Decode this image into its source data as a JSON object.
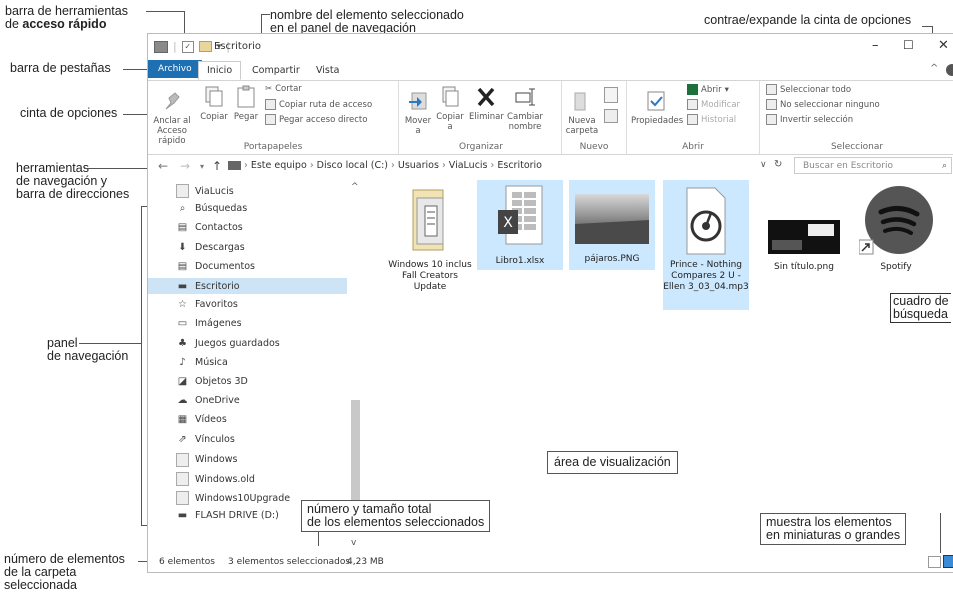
{
  "annotations": {
    "qat_1": "barra de herramientas",
    "qat_2_pre": "de ",
    "qat_2_bold": "acceso rápido",
    "selname_1": "nombre del elemento seleccionado",
    "selname_2": "en el panel de navegación",
    "collapse": "contrae/expande la cinta de opciones",
    "tabsbar": "barra de pestañas",
    "ribbon": "cinta de opciones",
    "navtools_1": "herramientas",
    "navtools_2": "de navegación y",
    "navtools_3": "barra de direcciones",
    "navpane_1": "panel",
    "navpane_2": "de navegación",
    "searchbox_1": "cuadro de",
    "searchbox_2": "búsqueda",
    "viewarea": "área de visualización",
    "selcount_1": "número y tamaño total",
    "selcount_2": "de los elementos seleccionados",
    "viewmode_1": "muestra los elementos",
    "viewmode_2": "en miniaturas o grandes",
    "itemcount_1": "número de elementos",
    "itemcount_2": "de la carpeta",
    "itemcount_3": "seleccionada"
  },
  "window": {
    "title": "Escritorio",
    "minimize": "–",
    "maximize": "☐",
    "close": "✕"
  },
  "tabs": [
    "Archivo",
    "Inicio",
    "Compartir",
    "Vista"
  ],
  "ribbon": {
    "pin": "Anclar al Acceso rápido",
    "copy": "Copiar",
    "paste": "Pegar",
    "cut": "Cortar",
    "copy_path": "Copiar ruta de acceso",
    "paste_shortcut": "Pegar acceso directo",
    "group_clipboard": "Portapapeles",
    "move": "Mover a",
    "copy_to": "Copiar a",
    "delete": "Eliminar",
    "rename": "Cambiar nombre",
    "group_organize": "Organizar",
    "new_folder": "Nueva carpeta",
    "group_new": "Nuevo",
    "properties": "Propiedades",
    "open": "Abrir",
    "edit": "Modificar",
    "history": "Historial",
    "group_open": "Abrir",
    "select_all": "Seleccionar todo",
    "select_none": "No seleccionar ninguno",
    "invert": "Invertir selección",
    "group_select": "Seleccionar"
  },
  "address": {
    "path": [
      "Este equipo",
      "Disco local (C:)",
      "Usuarios",
      "ViaLucis",
      "Escritorio"
    ],
    "search_placeholder": "Buscar en Escritorio"
  },
  "nav_items": [
    {
      "label": "ViaLucis",
      "icon": "folder-icon"
    },
    {
      "label": "Búsquedas",
      "icon": "search-icon"
    },
    {
      "label": "Contactos",
      "icon": "contacts-icon"
    },
    {
      "label": "Descargas",
      "icon": "download-icon"
    },
    {
      "label": "Documentos",
      "icon": "document-icon"
    },
    {
      "label": "Escritorio",
      "icon": "desktop-icon"
    },
    {
      "label": "Favoritos",
      "icon": "star-icon"
    },
    {
      "label": "Imágenes",
      "icon": "pictures-icon"
    },
    {
      "label": "Juegos guardados",
      "icon": "games-icon"
    },
    {
      "label": "Música",
      "icon": "music-icon"
    },
    {
      "label": "Objetos 3D",
      "icon": "cube-icon"
    },
    {
      "label": "OneDrive",
      "icon": "cloud-icon"
    },
    {
      "label": "Vídeos",
      "icon": "video-icon"
    },
    {
      "label": "Vínculos",
      "icon": "link-icon"
    },
    {
      "label": "Windows",
      "icon": "folder-icon"
    },
    {
      "label": "Windows.old",
      "icon": "folder-icon"
    },
    {
      "label": "Windows10Upgrade",
      "icon": "folder-icon"
    },
    {
      "label": "FLASH DRIVE (D:)",
      "icon": "drive-icon"
    }
  ],
  "files": [
    {
      "name": "Windows 10 inclus Fall Creators Update",
      "kind": "folder",
      "selected": false
    },
    {
      "name": "Libro1.xlsx",
      "kind": "excel",
      "selected": true
    },
    {
      "name": "pájaros.PNG",
      "kind": "image",
      "selected": true
    },
    {
      "name": "Prince - Nothing Compares 2 U - Ellen 3_03_04.mp3",
      "kind": "audio",
      "selected": true
    },
    {
      "name": "Sin título.png",
      "kind": "image",
      "selected": false
    },
    {
      "name": "Spotify",
      "kind": "shortcut",
      "selected": false
    }
  ],
  "status": {
    "count": "6 elementos",
    "selected": "3 elementos seleccionados",
    "size": "4,23 MB"
  }
}
